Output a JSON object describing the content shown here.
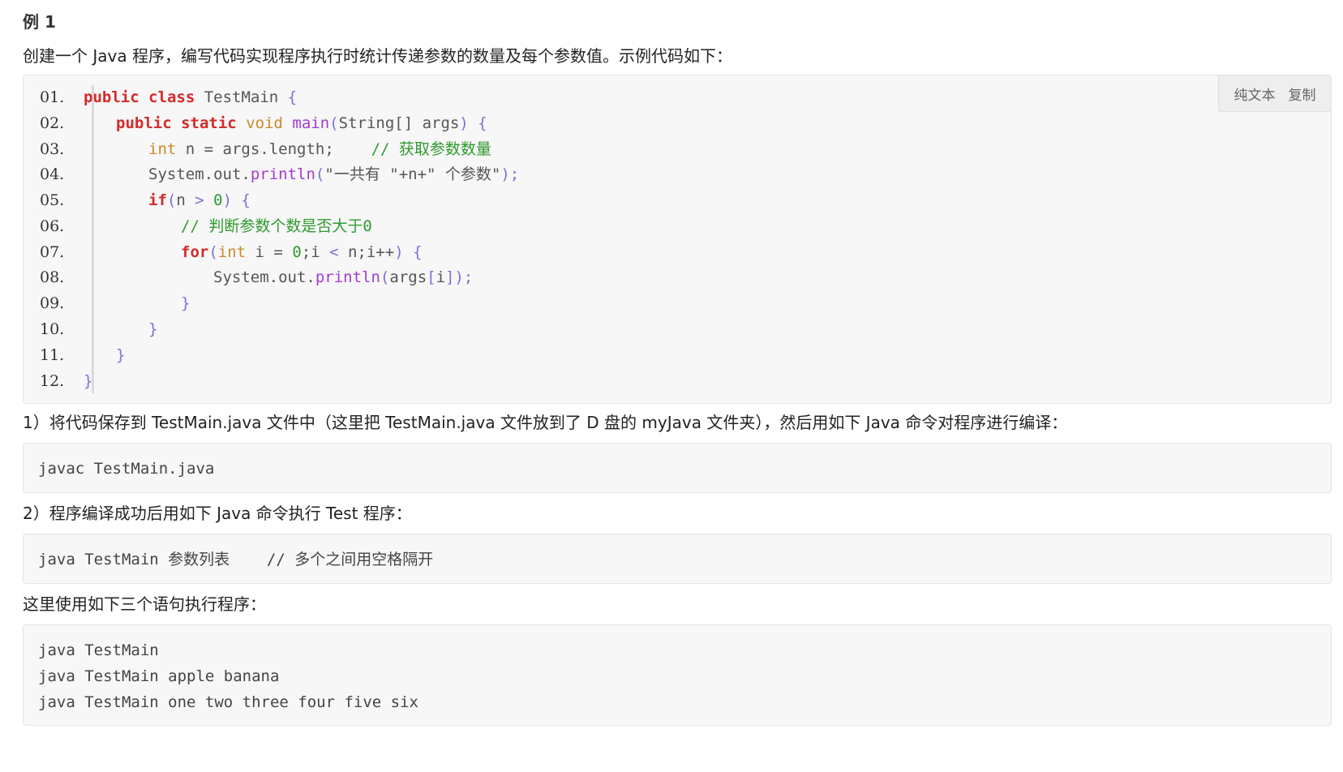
{
  "heading": "例 1",
  "intro": "创建一个 Java 程序，编写代码实现程序执行时统计传递参数的数量及每个参数值。示例代码如下：",
  "toolbar": {
    "plain_text": "纯文本",
    "copy": "复制"
  },
  "line_numbers": [
    "01.",
    "02.",
    "03.",
    "04.",
    "05.",
    "06.",
    "07.",
    "08.",
    "09.",
    "10.",
    "11.",
    "12."
  ],
  "code": {
    "l1": {
      "kw1": "public",
      "kw2": "class",
      "rest": " TestMain ",
      "brace": "{"
    },
    "l2": {
      "kw1": "public",
      "kw2": "static",
      "ty": "void",
      "fn": "main",
      "p1": "(",
      "args": "String[] args",
      "p2": ")",
      "brace": "{"
    },
    "l3": {
      "ty": "int",
      "mid": " n = args.length;",
      "comment": "// 获取参数数量"
    },
    "l4": {
      "pre": "System.out.",
      "fn": "println",
      "p1": "(",
      "str": "\"一共有 \"+n+\" 个参数\"",
      "p2": ");"
    },
    "l5": {
      "kw": "if",
      "p1": "(",
      "mid": "n ",
      "op": ">",
      "num": " 0",
      "p2": ")",
      "brace": "{"
    },
    "l6": {
      "comment": "// 判断参数个数是否大于0"
    },
    "l7": {
      "kw": "for",
      "p1": "(",
      "ty": "int",
      "a": " i = ",
      "num": "0",
      "b": ";i ",
      "op": "<",
      "c": " n;i++",
      "p2": ")",
      "brace": "{"
    },
    "l8": {
      "pre": "System.out.",
      "fn": "println",
      "p1": "(",
      "mid": "args",
      "p2": "[",
      "idx": "i",
      "p3": "]);"
    },
    "l9": {
      "brace": "}"
    },
    "l10": {
      "brace": "}"
    },
    "l11": {
      "brace": "}"
    },
    "l12": {
      "brace": "}"
    }
  },
  "step1": "1）将代码保存到 TestMain.java 文件中（这里把 TestMain.java 文件放到了 D 盘的 myJava 文件夹），然后用如下 Java 命令对程序进行编译：",
  "step1_code": "javac TestMain.java",
  "step2": "2）程序编译成功后用如下 Java 命令执行 Test 程序：",
  "step2_code": "java TestMain 参数列表    // 多个之间用空格隔开",
  "step3": "这里使用如下三个语句执行程序：",
  "step3_code": [
    "java TestMain",
    "java TestMain apple banana",
    "java TestMain one two three four five six"
  ]
}
